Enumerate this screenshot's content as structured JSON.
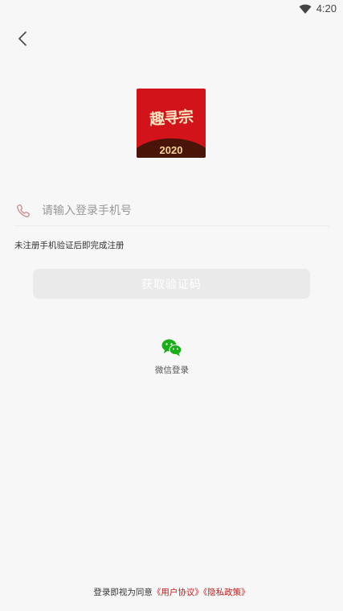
{
  "status_bar": {
    "time": "4:20",
    "wifi_icon": "wifi-icon"
  },
  "nav": {
    "back_icon": "chevron-left-icon"
  },
  "logo": {
    "text": "趣寻宗",
    "year": "2020",
    "brand_color": "#d2141a"
  },
  "login_form": {
    "phone_icon": "phone-icon",
    "phone_placeholder": "请输入登录手机号",
    "phone_value": "",
    "hint": "未注册手机验证后即完成注册",
    "get_code_label": "获取验证码"
  },
  "wechat": {
    "icon": "wechat-icon",
    "label": "微信登录",
    "color": "#1aad19"
  },
  "agreement": {
    "prefix": "登录即视为同意",
    "user_agreement": "《用户协议》",
    "privacy_policy": "《隐私政策》",
    "link_color": "#c61a1a"
  }
}
